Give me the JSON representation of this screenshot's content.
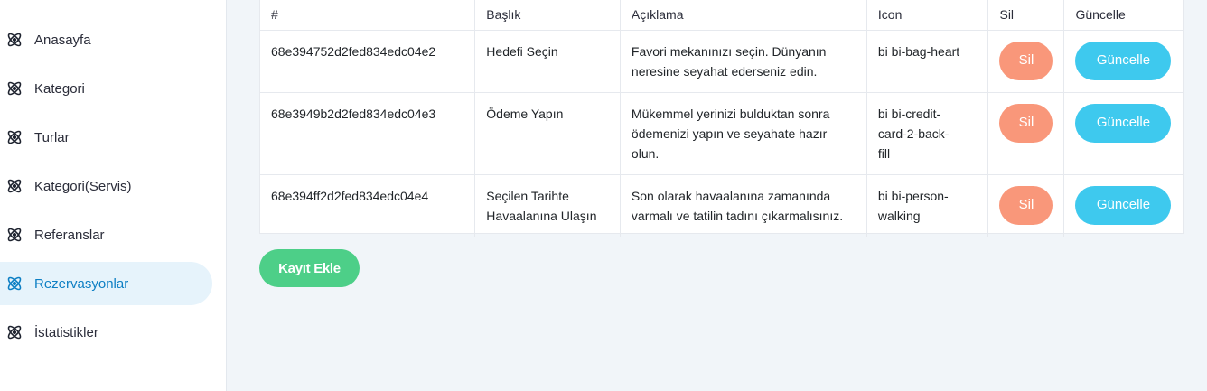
{
  "sidebar": {
    "items": [
      {
        "label": "Anasayfa",
        "icon": "atom-icon",
        "active": false
      },
      {
        "label": "Kategori",
        "icon": "atom-icon",
        "active": false
      },
      {
        "label": "Turlar",
        "icon": "atom-icon",
        "active": false
      },
      {
        "label": "Kategori(Servis)",
        "icon": "atom-icon",
        "active": false
      },
      {
        "label": "Referanslar",
        "icon": "atom-icon",
        "active": false
      },
      {
        "label": "Rezervasyonlar",
        "icon": "atom-icon",
        "active": true
      },
      {
        "label": "İstatistikler",
        "icon": "atom-icon",
        "active": false
      }
    ]
  },
  "table": {
    "headers": [
      "#",
      "Başlık",
      "Açıklama",
      "Icon",
      "Sil",
      "Güncelle"
    ],
    "rows": [
      {
        "id": "68e394752d2fed834edc04e2",
        "title": "Hedefi Seçin",
        "description": [
          "Favori mekanınızı seçin. Dünyanın",
          "neresine seyahat ederseniz edin."
        ],
        "icon": [
          "bi bi-bag-heart"
        ],
        "delete_label": "Sil",
        "update_label": "Güncelle"
      },
      {
        "id": "68e3949b2d2fed834edc04e3",
        "title": "Ödeme Yapın",
        "description": [
          "Mükemmel yerinizi bulduktan sonra",
          "ödemenizi yapın ve seyahate hazır",
          "olun."
        ],
        "icon": [
          "bi bi-credit-",
          "card-2-back-",
          "fill"
        ],
        "delete_label": "Sil",
        "update_label": "Güncelle"
      },
      {
        "id": "68e394ff2d2fed834edc04e4",
        "title": [
          "Seçilen Tarihte",
          "Havaalanına Ulaşın"
        ],
        "description": [
          "Son olarak havaalanına zamanında",
          "varmalı ve tatilin tadını çıkarmalısınız."
        ],
        "icon": [
          "bi bi-person-",
          "walking"
        ],
        "delete_label": "Sil",
        "update_label": "Güncelle"
      }
    ]
  },
  "actions": {
    "add_label": "Kayıt Ekle"
  },
  "colors": {
    "active_nav_bg": "#e6f3fb",
    "active_nav_text": "#0d7fc4",
    "delete_button": "#f9977a",
    "update_button": "#3ec9ee",
    "add_button": "#4dcf88"
  }
}
